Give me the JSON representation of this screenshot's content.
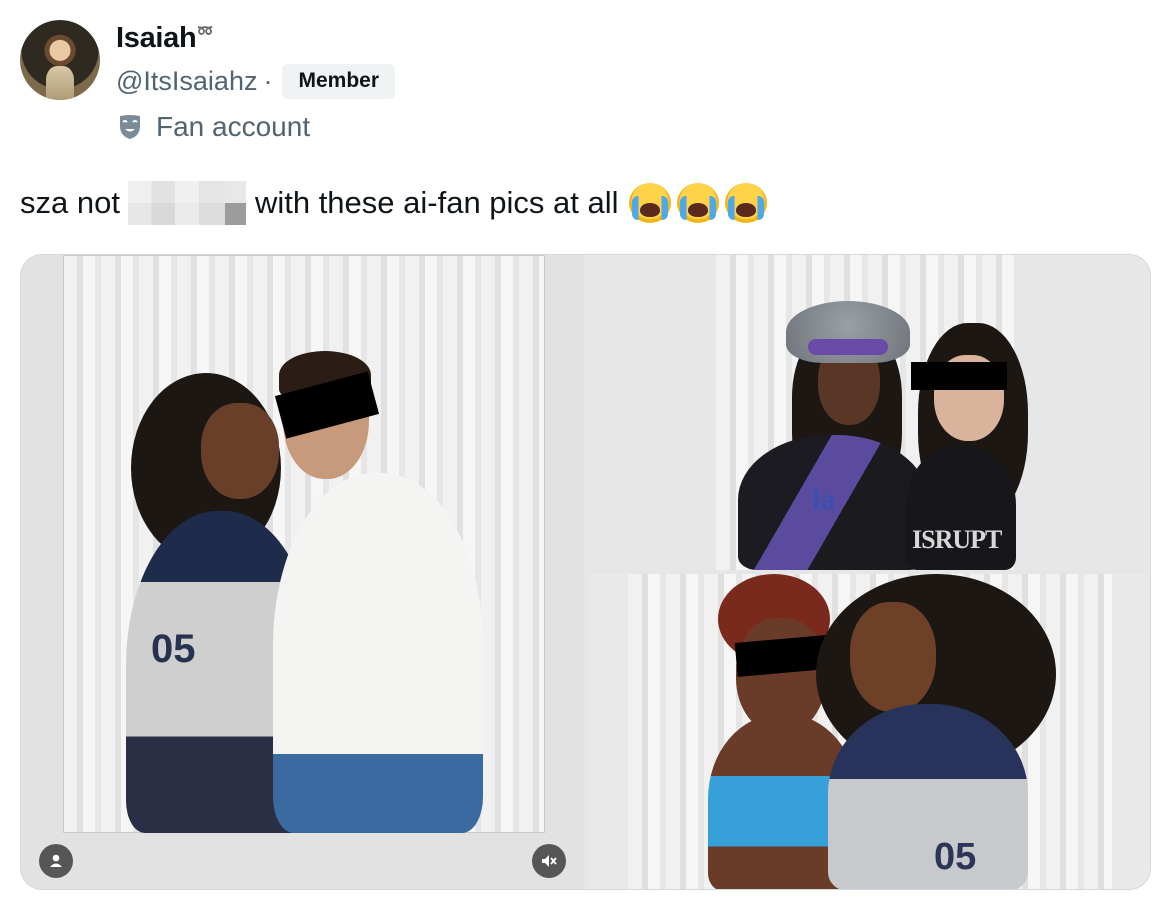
{
  "author": {
    "display_name": "Isaiah",
    "name_emoji": "➿",
    "handle": "@ItsIsaiahz",
    "separator": "·",
    "badge": "Member",
    "label": "Fan account"
  },
  "tweet": {
    "text_before": "sza not",
    "text_after": "with these ai-fan pics at all",
    "emojis": [
      "loudly-crying-face",
      "loudly-crying-face",
      "loudly-crying-face"
    ]
  },
  "media": {
    "photo_count": 3,
    "main_photo": {
      "jersey_text": "05"
    },
    "top_right_photo": {
      "jersey_text": "la",
      "shirt_text": "ISRUPT"
    },
    "bottom_right_photo": {
      "jersey_text": "05"
    }
  },
  "controls": {
    "tag_icon": "person-icon",
    "mute_icon": "muted-speaker-icon"
  },
  "colors": {
    "text_primary": "#0f1419",
    "text_secondary": "#536471",
    "badge_bg": "#eff3f4",
    "border": "#cfd9de"
  }
}
